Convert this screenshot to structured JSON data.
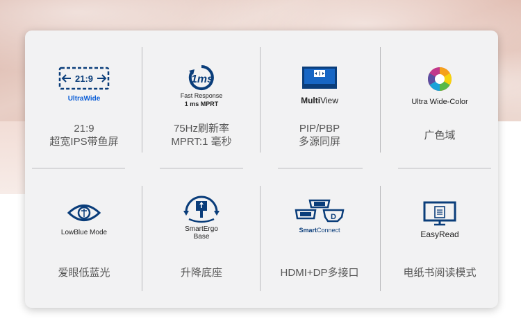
{
  "features": [
    {
      "icon": "ultrawide-icon",
      "label": "UltraWide",
      "badge": "21:9",
      "line1": "21:9",
      "line2": "超宽IPS带鱼屏"
    },
    {
      "icon": "fast-response-icon",
      "label_top": "Fast Response",
      "label_bottom": "1 ms MPRT",
      "badge": "1ms",
      "line1": "75Hz刷新率",
      "line2": "MPRT:1 毫秒"
    },
    {
      "icon": "multiview-icon",
      "label_strong": "Multi",
      "label_rest": "View",
      "line1": "PIP/PBP",
      "line2": "多源同屏"
    },
    {
      "icon": "ultra-wide-color-icon",
      "label": "Ultra Wide-Color",
      "line1": "广色域"
    },
    {
      "icon": "lowblue-eye-icon",
      "label": "LowBlue Mode",
      "line1": "爱眼低蓝光"
    },
    {
      "icon": "smartergo-base-icon",
      "label_top": "SmartErgo",
      "label_bottom": "Base",
      "line1": "升降底座"
    },
    {
      "icon": "smartconnect-icon",
      "label_strong": "Smart",
      "label_rest": "Connect",
      "line1": "HDMI+DP多接口"
    },
    {
      "icon": "easyread-icon",
      "label": "EasyRead",
      "line1": "电纸书阅读模式"
    }
  ],
  "colors": {
    "brand_blue": "#0b5ed7",
    "navy": "#0a3d7a",
    "text": "#555555"
  }
}
